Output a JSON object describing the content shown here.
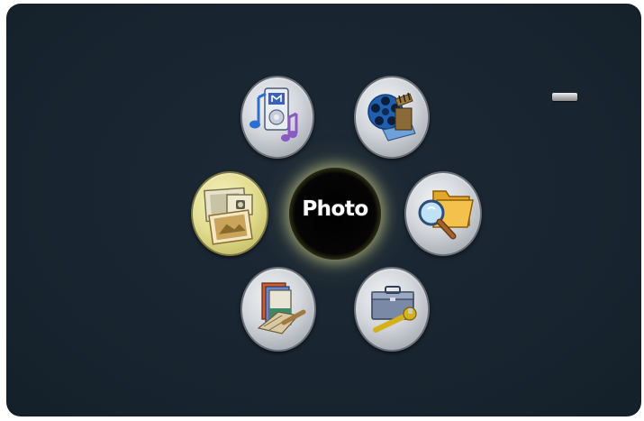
{
  "center": {
    "label": "Photo"
  },
  "menu": {
    "items": [
      {
        "name": "music",
        "icon": "music-player-icon"
      },
      {
        "name": "movie",
        "icon": "film-reel-icon"
      },
      {
        "name": "photo",
        "icon": "photos-icon",
        "selected": true
      },
      {
        "name": "file-browser",
        "icon": "folder-search-icon"
      },
      {
        "name": "edit",
        "icon": "book-brush-icon"
      },
      {
        "name": "setup",
        "icon": "toolbox-wrench-icon"
      }
    ]
  },
  "colors": {
    "background": "#18242f",
    "button": "#d2d6db",
    "selected_button": "#e4df93",
    "center_glow": "#e1e196"
  }
}
